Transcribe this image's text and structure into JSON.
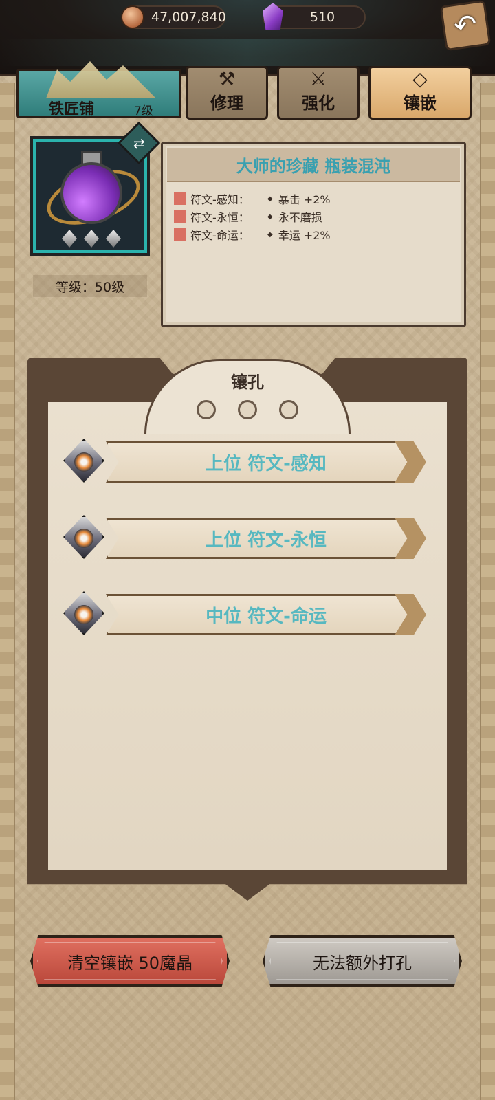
{
  "currency": {
    "gold": "47,007,840",
    "gems": "510"
  },
  "shop": {
    "name": "铁匠铺",
    "level": "7级"
  },
  "tabs": [
    {
      "label": "修理",
      "icon": "hammer-icon"
    },
    {
      "label": "强化",
      "icon": "sword-wings-icon"
    },
    {
      "label": "镶嵌",
      "icon": "gem-inlay-icon"
    }
  ],
  "item": {
    "name": "大师的珍藏 瓶装混沌",
    "level": "等级：50级",
    "attributes": [
      {
        "rune": "符文-感知：",
        "effect": "暴击 +2%"
      },
      {
        "rune": "符文-永恒：",
        "effect": "永不磨损"
      },
      {
        "rune": "符文-命运：",
        "effect": "幸运 +2%"
      }
    ]
  },
  "sockets": {
    "title": "镶孔",
    "runes": [
      {
        "label": "上位 符文-感知"
      },
      {
        "label": "上位 符文-永恒"
      },
      {
        "label": "中位 符文-命运"
      }
    ]
  },
  "buttons": {
    "clear": "清空镶嵌 50魔晶",
    "no_extra": "无法额外打孔"
  },
  "colors": {
    "accent_teal": "#57b8c0",
    "attribute_marker": "#d97062",
    "clear_button": "#c95a4a",
    "disabled_button": "#b7b2ab"
  }
}
